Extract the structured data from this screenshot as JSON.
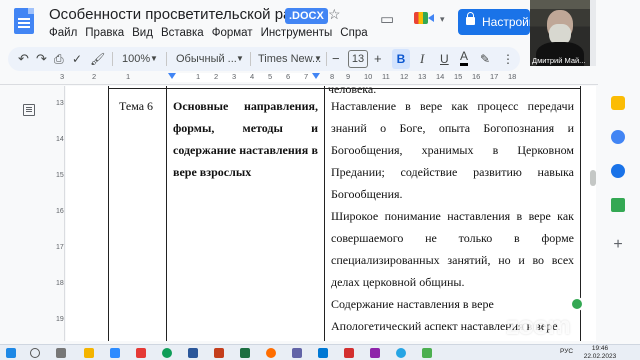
{
  "header": {
    "title": "Особенности просветительской ра",
    "file_badge": ".DOCX",
    "share_label": "Настройк",
    "menu": [
      "Файл",
      "Правка",
      "Вид",
      "Вставка",
      "Формат",
      "Инструменты",
      "Спра"
    ]
  },
  "toolbar": {
    "zoom": "100%",
    "style": "Обычный ...",
    "font": "Times New...",
    "font_size": "13",
    "minus": "−",
    "plus": "+",
    "bold": "B",
    "italic": "I",
    "underline": "U",
    "text_color": "A"
  },
  "ruler": {
    "numbers": [
      "3",
      "2",
      "1",
      "1",
      "2",
      "3",
      "4",
      "5",
      "6",
      "7",
      "8",
      "9",
      "10",
      "11",
      "12",
      "13",
      "14",
      "15",
      "16",
      "17",
      "18"
    ]
  },
  "vertical_ruler": [
    "13",
    "14",
    "15",
    "16",
    "17",
    "18",
    "19"
  ],
  "video": {
    "participant_name": "Дмитрий Май..."
  },
  "document": {
    "previous_row_text": "человека.",
    "row": {
      "col1": "Тема 6",
      "col2": "Основные направления, формы, методы и содержание наставления в вере взрослых",
      "col3_paragraphs": [
        "Наставление в вере как процесс передачи знаний о Боге, опыта Богопознания и Богообщения, хранимых в Церковном Предании; содействие развитию навыка Богообщения.",
        "Широкое понимание наставления в вере как совершаемого не только в форме специализированных занятий, но и во всех делах церковной общины.",
        "Содержание наставления в вере",
        "Апологетический аспект наставления в вере."
      ]
    }
  },
  "watermark": "zoom",
  "taskbar": {
    "lang": "РУС",
    "time": "19:46",
    "date": "22.02.2023"
  },
  "colors": {
    "accent": "#1a73e8",
    "docs_blue": "#4285f4"
  }
}
